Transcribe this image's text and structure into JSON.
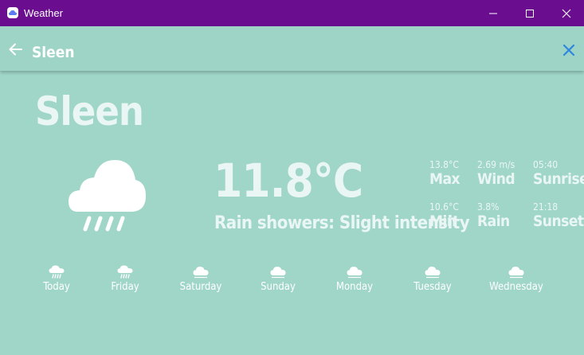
{
  "window": {
    "title": "Weather"
  },
  "colors": {
    "titlebar": "#6a0d8f",
    "background": "#a0d6c8",
    "close_accent": "#2e86de"
  },
  "appbar": {
    "title": "Sleen",
    "back_icon": "arrow-left-icon",
    "close_icon": "close-icon"
  },
  "main": {
    "city": "Sleen",
    "temperature": "11.8°C",
    "description": "Rain showers: Slight intensity",
    "icon": "cloud-rain-icon"
  },
  "stats": {
    "max": {
      "value": "13.8°C",
      "label": "Max"
    },
    "wind": {
      "value": "2.69 m/s",
      "label": "Wind"
    },
    "sunrise": {
      "value": "05:40",
      "label": "Sunrise"
    },
    "min": {
      "value": "10.6°C",
      "label": "Min"
    },
    "rain": {
      "value": "3.8%",
      "label": "Rain"
    },
    "sunset": {
      "value": "21:18",
      "label": "Sunset"
    }
  },
  "forecast": [
    {
      "day": "Today",
      "icon": "cloud-rain-icon"
    },
    {
      "day": "Friday",
      "icon": "cloud-rain-icon"
    },
    {
      "day": "Saturday",
      "icon": "cloud-icon"
    },
    {
      "day": "Sunday",
      "icon": "cloud-icon"
    },
    {
      "day": "Monday",
      "icon": "cloud-icon"
    },
    {
      "day": "Tuesday",
      "icon": "cloud-icon"
    },
    {
      "day": "Wednesday",
      "icon": "cloud-icon"
    }
  ]
}
